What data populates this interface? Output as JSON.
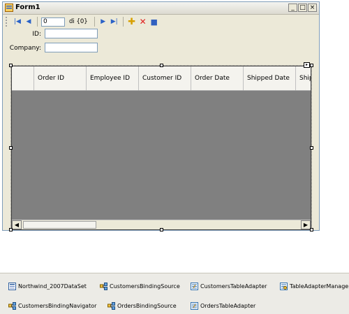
{
  "window": {
    "title": "Form1",
    "minimize_glyph": "_",
    "maximize_glyph": "□",
    "close_glyph": "×"
  },
  "navigator": {
    "position_value": "0",
    "count_label": "di {0}",
    "first_glyph": "|◀",
    "prev_glyph": "◀",
    "next_glyph": "▶",
    "last_glyph": "▶|",
    "add_glyph": "✚",
    "delete_glyph": "✕",
    "save_glyph": "■"
  },
  "fields": {
    "id_label": "ID:",
    "company_label": "Company:",
    "id_value": "",
    "company_value": ""
  },
  "grid": {
    "columns": [
      "Order ID",
      "Employee ID",
      "Customer ID",
      "Order Date",
      "Shipped Date",
      "Ship"
    ],
    "scroll_left_glyph": "◀",
    "scroll_right_glyph": "▶"
  },
  "tray": {
    "items": [
      {
        "label": "Northwind_2007DataSet",
        "icon": "dataset-icon"
      },
      {
        "label": "CustomersBindingSource",
        "icon": "binding-source-icon"
      },
      {
        "label": "CustomersTableAdapter",
        "icon": "table-adapter-icon"
      },
      {
        "label": "TableAdapterManager",
        "icon": "table-adapter-manager-icon"
      },
      {
        "label": "CustomersBindingNavigator",
        "icon": "binding-navigator-icon"
      },
      {
        "label": "OrdersBindingSource",
        "icon": "binding-source-icon"
      },
      {
        "label": "OrdersTableAdapter",
        "icon": "table-adapter-icon"
      }
    ]
  }
}
